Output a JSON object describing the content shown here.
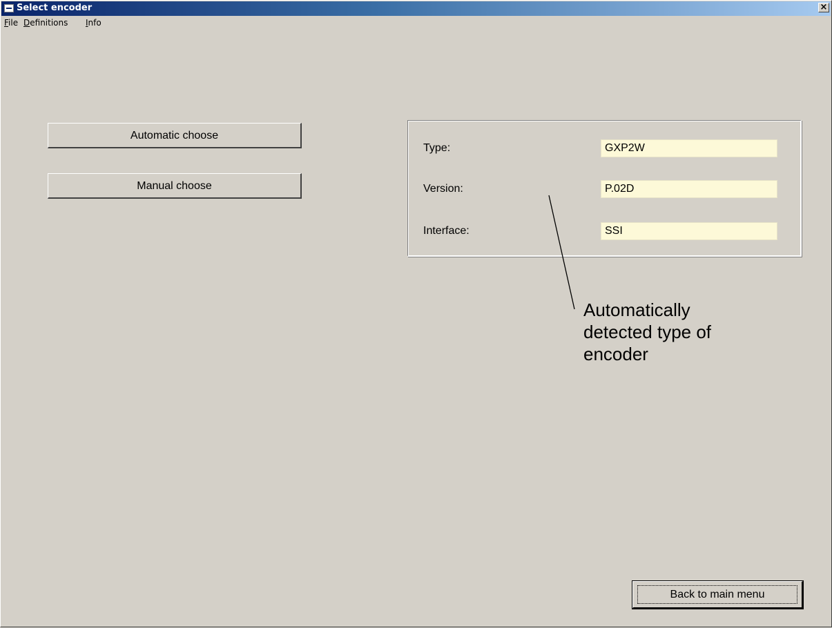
{
  "window": {
    "title": "Select encoder",
    "close_glyph": "×"
  },
  "menu": {
    "file": {
      "accel": "F",
      "rest": "ile"
    },
    "definitions": {
      "accel": "D",
      "rest": "efinitions"
    },
    "info": {
      "accel": "I",
      "rest": "nfo"
    }
  },
  "buttons": {
    "automatic": "Automatic choose",
    "manual": "Manual choose",
    "back": "Back to main menu"
  },
  "encoder_info": {
    "type_label": "Type:",
    "type_value": "GXP2W",
    "version_label": "Version:",
    "version_value": "P.02D",
    "interface_label": "Interface:",
    "interface_value": "SSI"
  },
  "annotation": {
    "line1": "Automatically",
    "line2": "detected type of",
    "line3": "encoder"
  },
  "colors": {
    "face": "#d4d0c8",
    "titlebar_start": "#0a246a",
    "titlebar_end": "#a6caf0",
    "field_bg": "#fdf9d8"
  }
}
